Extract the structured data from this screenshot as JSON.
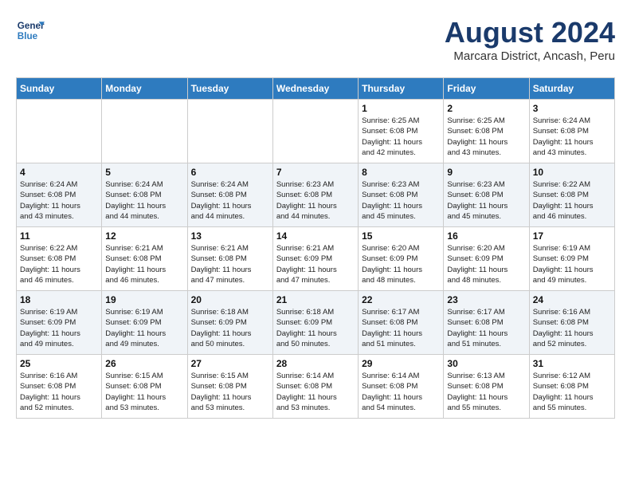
{
  "header": {
    "logo_line1": "General",
    "logo_line2": "Blue",
    "month": "August 2024",
    "location": "Marcara District, Ancash, Peru"
  },
  "weekdays": [
    "Sunday",
    "Monday",
    "Tuesday",
    "Wednesday",
    "Thursday",
    "Friday",
    "Saturday"
  ],
  "weeks": [
    [
      {
        "day": "",
        "info": ""
      },
      {
        "day": "",
        "info": ""
      },
      {
        "day": "",
        "info": ""
      },
      {
        "day": "",
        "info": ""
      },
      {
        "day": "1",
        "info": "Sunrise: 6:25 AM\nSunset: 6:08 PM\nDaylight: 11 hours\nand 42 minutes."
      },
      {
        "day": "2",
        "info": "Sunrise: 6:25 AM\nSunset: 6:08 PM\nDaylight: 11 hours\nand 43 minutes."
      },
      {
        "day": "3",
        "info": "Sunrise: 6:24 AM\nSunset: 6:08 PM\nDaylight: 11 hours\nand 43 minutes."
      }
    ],
    [
      {
        "day": "4",
        "info": "Sunrise: 6:24 AM\nSunset: 6:08 PM\nDaylight: 11 hours\nand 43 minutes."
      },
      {
        "day": "5",
        "info": "Sunrise: 6:24 AM\nSunset: 6:08 PM\nDaylight: 11 hours\nand 44 minutes."
      },
      {
        "day": "6",
        "info": "Sunrise: 6:24 AM\nSunset: 6:08 PM\nDaylight: 11 hours\nand 44 minutes."
      },
      {
        "day": "7",
        "info": "Sunrise: 6:23 AM\nSunset: 6:08 PM\nDaylight: 11 hours\nand 44 minutes."
      },
      {
        "day": "8",
        "info": "Sunrise: 6:23 AM\nSunset: 6:08 PM\nDaylight: 11 hours\nand 45 minutes."
      },
      {
        "day": "9",
        "info": "Sunrise: 6:23 AM\nSunset: 6:08 PM\nDaylight: 11 hours\nand 45 minutes."
      },
      {
        "day": "10",
        "info": "Sunrise: 6:22 AM\nSunset: 6:08 PM\nDaylight: 11 hours\nand 46 minutes."
      }
    ],
    [
      {
        "day": "11",
        "info": "Sunrise: 6:22 AM\nSunset: 6:08 PM\nDaylight: 11 hours\nand 46 minutes."
      },
      {
        "day": "12",
        "info": "Sunrise: 6:21 AM\nSunset: 6:08 PM\nDaylight: 11 hours\nand 46 minutes."
      },
      {
        "day": "13",
        "info": "Sunrise: 6:21 AM\nSunset: 6:08 PM\nDaylight: 11 hours\nand 47 minutes."
      },
      {
        "day": "14",
        "info": "Sunrise: 6:21 AM\nSunset: 6:09 PM\nDaylight: 11 hours\nand 47 minutes."
      },
      {
        "day": "15",
        "info": "Sunrise: 6:20 AM\nSunset: 6:09 PM\nDaylight: 11 hours\nand 48 minutes."
      },
      {
        "day": "16",
        "info": "Sunrise: 6:20 AM\nSunset: 6:09 PM\nDaylight: 11 hours\nand 48 minutes."
      },
      {
        "day": "17",
        "info": "Sunrise: 6:19 AM\nSunset: 6:09 PM\nDaylight: 11 hours\nand 49 minutes."
      }
    ],
    [
      {
        "day": "18",
        "info": "Sunrise: 6:19 AM\nSunset: 6:09 PM\nDaylight: 11 hours\nand 49 minutes."
      },
      {
        "day": "19",
        "info": "Sunrise: 6:19 AM\nSunset: 6:09 PM\nDaylight: 11 hours\nand 49 minutes."
      },
      {
        "day": "20",
        "info": "Sunrise: 6:18 AM\nSunset: 6:09 PM\nDaylight: 11 hours\nand 50 minutes."
      },
      {
        "day": "21",
        "info": "Sunrise: 6:18 AM\nSunset: 6:09 PM\nDaylight: 11 hours\nand 50 minutes."
      },
      {
        "day": "22",
        "info": "Sunrise: 6:17 AM\nSunset: 6:08 PM\nDaylight: 11 hours\nand 51 minutes."
      },
      {
        "day": "23",
        "info": "Sunrise: 6:17 AM\nSunset: 6:08 PM\nDaylight: 11 hours\nand 51 minutes."
      },
      {
        "day": "24",
        "info": "Sunrise: 6:16 AM\nSunset: 6:08 PM\nDaylight: 11 hours\nand 52 minutes."
      }
    ],
    [
      {
        "day": "25",
        "info": "Sunrise: 6:16 AM\nSunset: 6:08 PM\nDaylight: 11 hours\nand 52 minutes."
      },
      {
        "day": "26",
        "info": "Sunrise: 6:15 AM\nSunset: 6:08 PM\nDaylight: 11 hours\nand 53 minutes."
      },
      {
        "day": "27",
        "info": "Sunrise: 6:15 AM\nSunset: 6:08 PM\nDaylight: 11 hours\nand 53 minutes."
      },
      {
        "day": "28",
        "info": "Sunrise: 6:14 AM\nSunset: 6:08 PM\nDaylight: 11 hours\nand 53 minutes."
      },
      {
        "day": "29",
        "info": "Sunrise: 6:14 AM\nSunset: 6:08 PM\nDaylight: 11 hours\nand 54 minutes."
      },
      {
        "day": "30",
        "info": "Sunrise: 6:13 AM\nSunset: 6:08 PM\nDaylight: 11 hours\nand 55 minutes."
      },
      {
        "day": "31",
        "info": "Sunrise: 6:12 AM\nSunset: 6:08 PM\nDaylight: 11 hours\nand 55 minutes."
      }
    ]
  ]
}
